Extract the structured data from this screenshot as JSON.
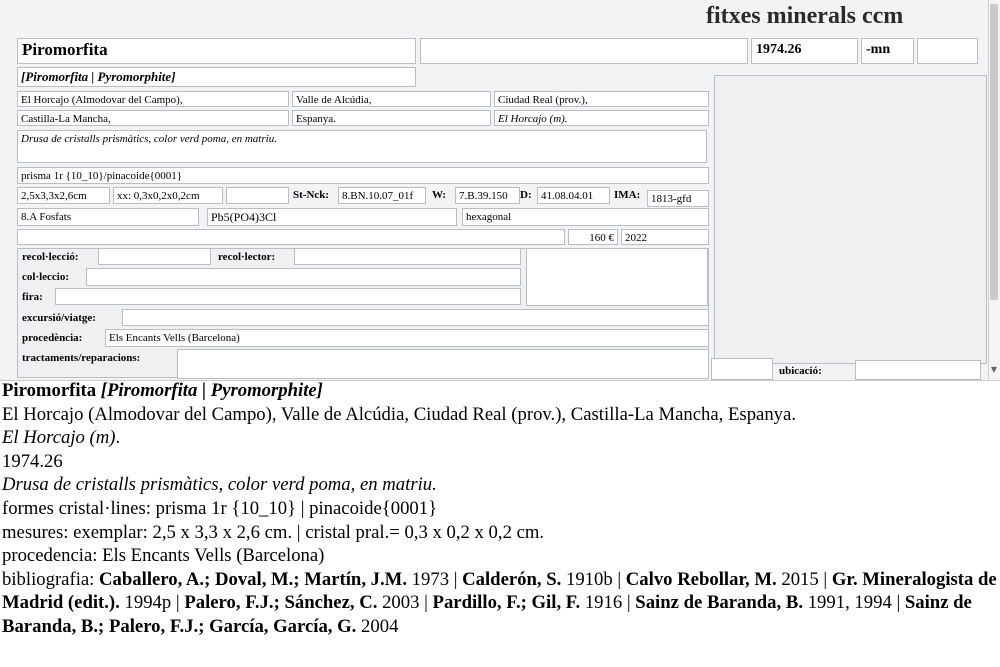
{
  "app_title": "fitxes minerals ccm",
  "form": {
    "name": "Piromorfita",
    "blank_top": "",
    "number": "1974.26",
    "suffix": "-mn",
    "suffix_blank": "",
    "names": "[Piromorfita | Pyromorphite]",
    "locality_1": "El Horcajo (Almodovar del Campo),",
    "locality_2": "Valle de Alcúdia,",
    "locality_3": "Ciudad Real (prov.),",
    "locality_4": "Castilla-La Mancha,",
    "locality_5": "Espanya.",
    "locality_6": "El Horcajo (m).",
    "description": "Drusa de cristalls prismàtics, color verd poma, en matriu.",
    "forms": "prisma 1r {10_10}/pinacoide{0001}",
    "size": "2,5x3,3x2,6cm",
    "crystal_size": "xx: 0,3x0,2x0,2cm",
    "size_blank": "",
    "st_nck_label": "St-Nck:",
    "st_nck": "8.BN.10.07_01f",
    "w_label": "W:",
    "w": "7.B.39.150",
    "d_label": "D:",
    "d": "41.08.04.01",
    "ima_label": "IMA:",
    "ima": "1813-gfd",
    "class": "8.A Fosfats",
    "formula": "Pb5(PO4)3Cl",
    "system": "hexagonal",
    "blank_price_row": "",
    "price": "160 €",
    "year": "2022",
    "recoleccio_label": "recol·lecció:",
    "recoleccio": "",
    "recolector_label": "recol·lector:",
    "recolector": "",
    "colleccio_label": "col·leccio:",
    "colleccio": "",
    "fira_label": "fira:",
    "fira": "",
    "excursio_label": "excursió/viatge:",
    "excursio": "",
    "procedencia_label": "procedència:",
    "procedencia": "Els Encants Vells (Barcelona)",
    "tractaments_label": "tractaments/reparacions:",
    "tractaments": "",
    "ubicacio_label": "ubicació:",
    "ubicacio": ""
  },
  "record": {
    "name": "Piromorfita",
    "names": "[Piromorfita | Pyromorphite]",
    "locality": "El Horcajo (Almodovar del Campo), Valle de Alcúdia, Ciudad Real (prov.), Castilla-La Mancha, Espanya.",
    "locality_short": "El Horcajo (m)",
    "period": ".",
    "number": "1974.26",
    "description": "Drusa de cristalls prismàtics, color verd poma, en matriu.",
    "forms": "formes cristal·lines: prisma 1r {10_10} | pinacoide{0001}",
    "measures": "mesures: exemplar: 2,5 x 3,3 x 2,6 cm. | cristal pral.= 0,3 x 0,2 x 0,2 cm.",
    "procedencia": "procedencia: Els Encants Vells (Barcelona)",
    "bibliography_label": "bibliografia: ",
    "bibliography": [
      {
        "authors": "Caballero, A.; Doval, M.; Martín, J.M.",
        "year": " 1973"
      },
      {
        "authors": "Calderón, S.",
        "year": " 1910b"
      },
      {
        "authors": "Calvo Rebollar, M.",
        "year": " 2015"
      },
      {
        "authors": "Gr. Mineralogista de Madrid (edit.).",
        "year": " 1994p"
      },
      {
        "authors": "Palero, F.J.; Sánchez, C.",
        "year": " 2003"
      },
      {
        "authors": "Pardillo, F.; Gil, F.",
        "year": " 1916"
      },
      {
        "authors": "Sainz de Baranda, B.",
        "year": " 1991, 1994"
      },
      {
        "authors": "Sainz de Baranda, B.; Palero, F.J.; García, García, G.",
        "year": " 2004"
      }
    ],
    "separator": " | "
  }
}
